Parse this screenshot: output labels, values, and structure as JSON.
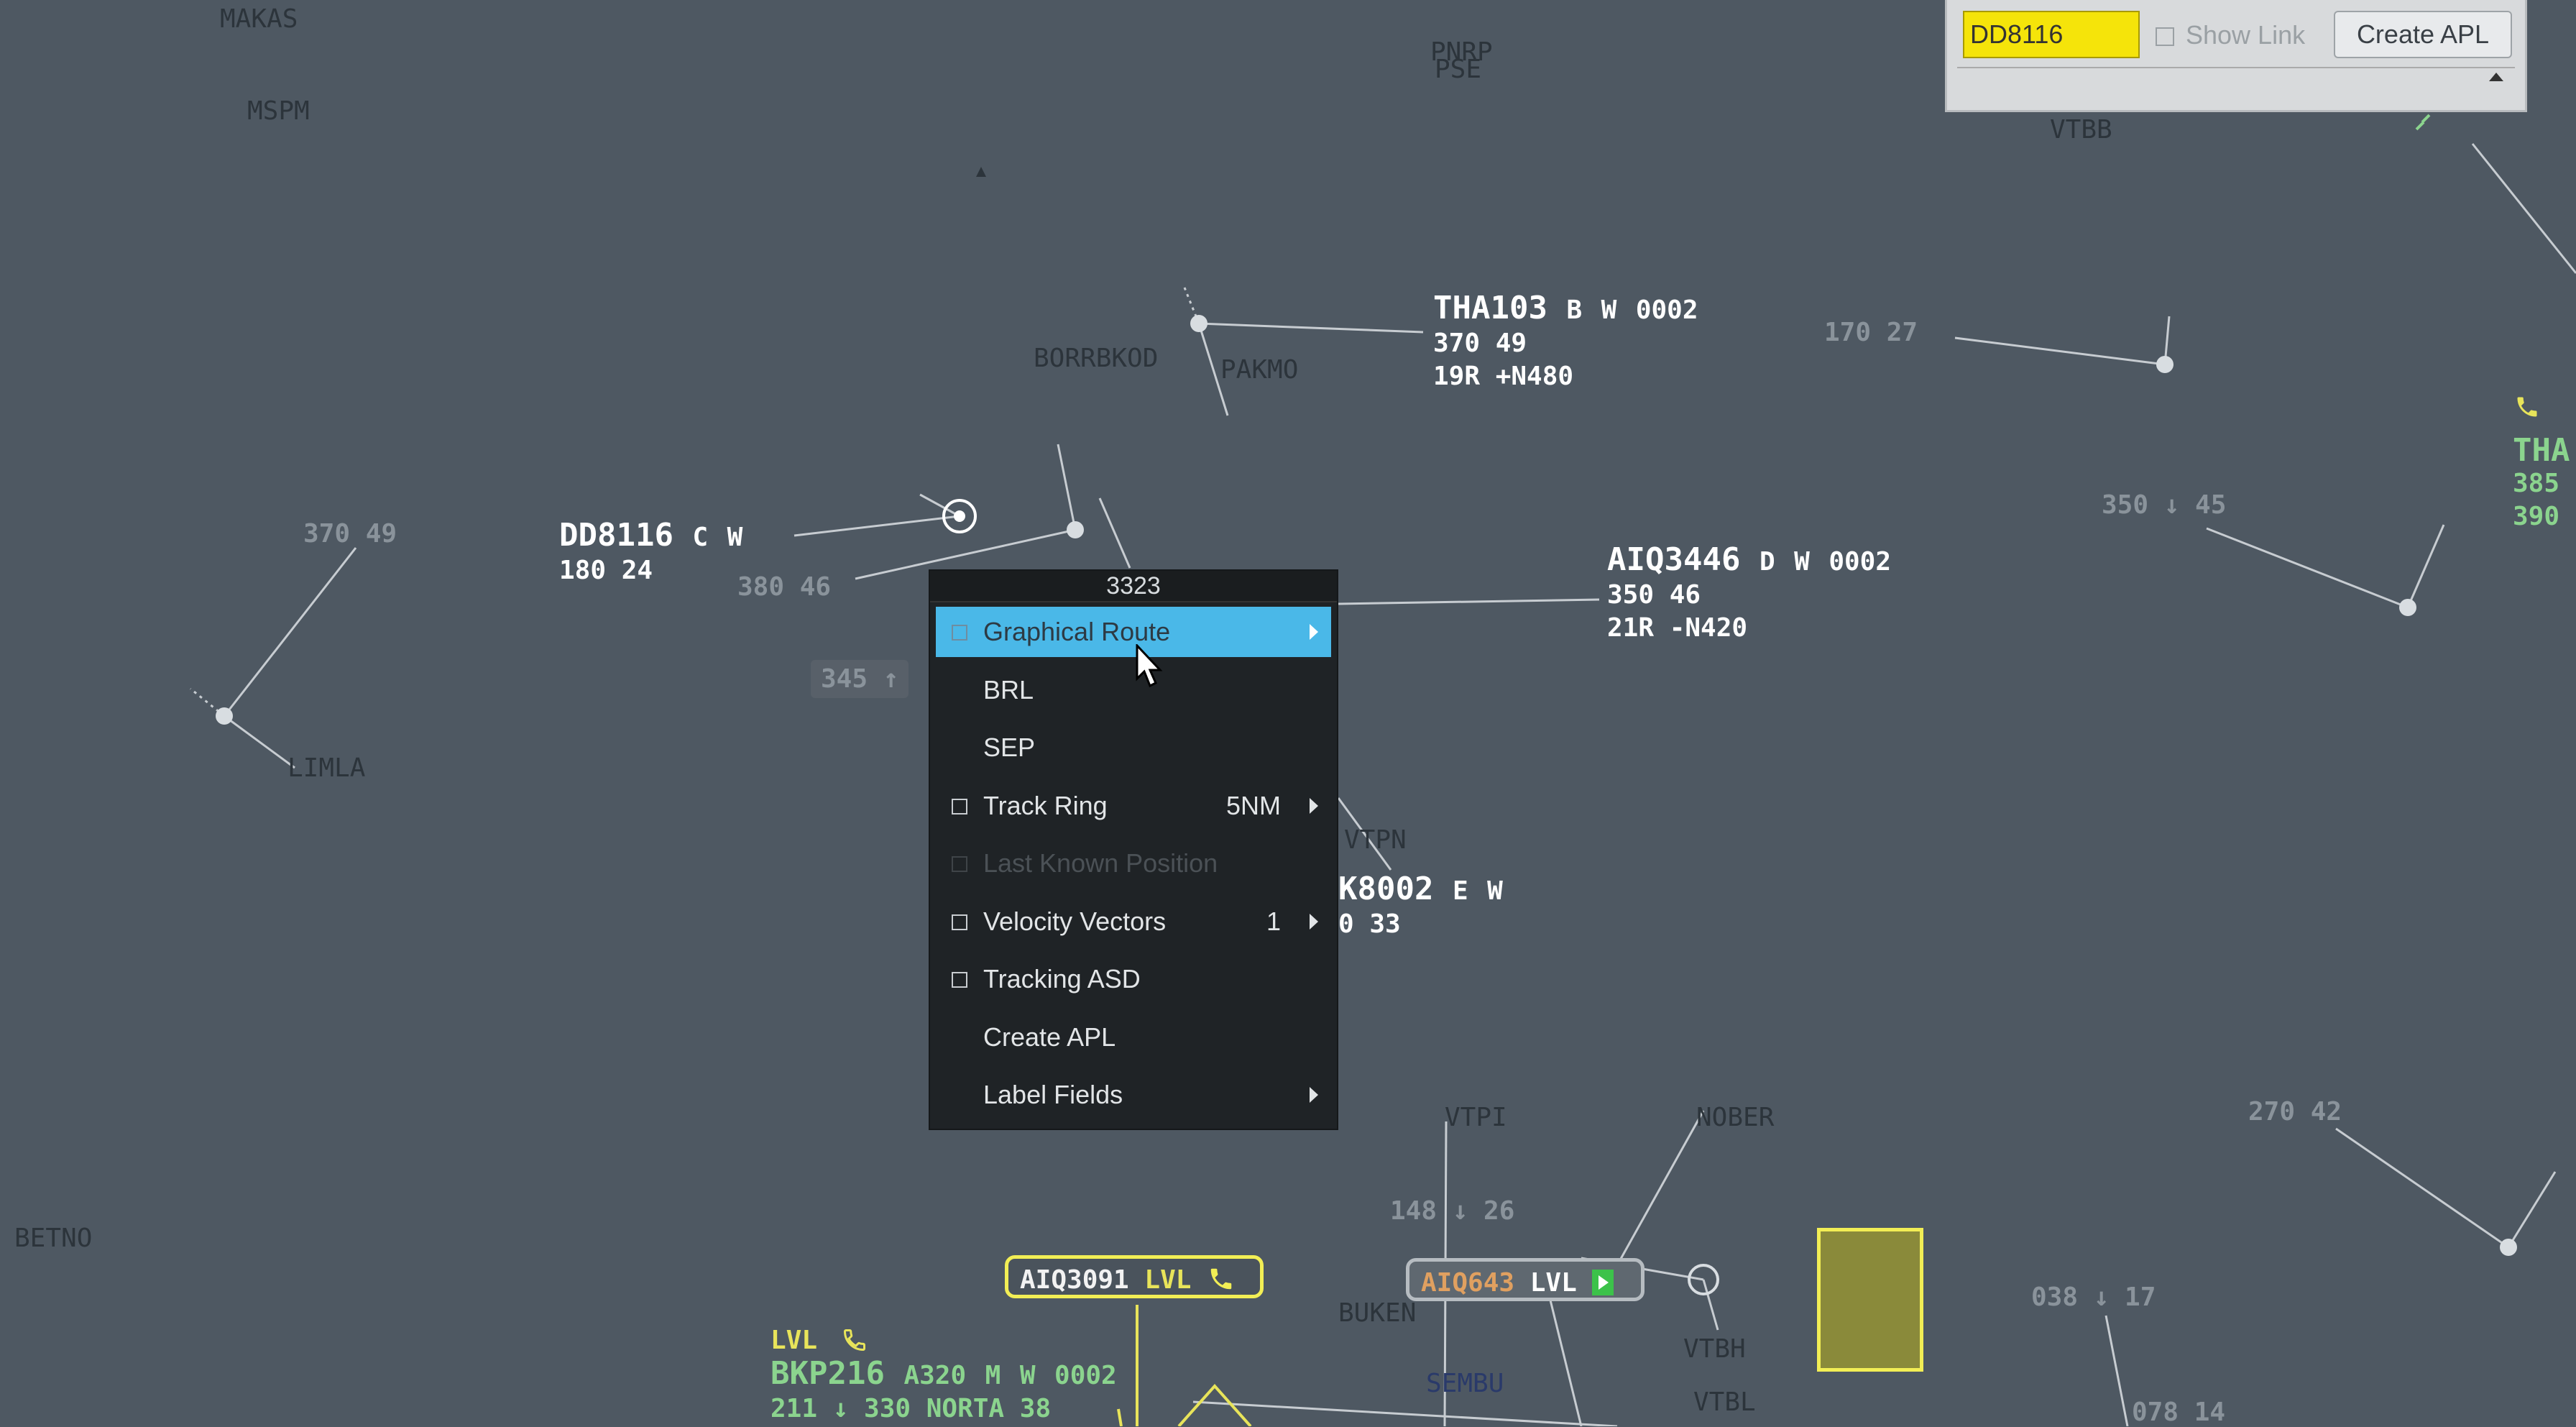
{
  "panel": {
    "callsign_value": "DD8116",
    "show_link_label": "Show Link",
    "create_apl_label": "Create APL"
  },
  "waypoints": {
    "makas": "MAKAS",
    "mspm": "MSPM",
    "borbkod": "BORRBKOD",
    "pakmo": "PAKMO",
    "limla": "LIMLA",
    "vtpn": "VTPN",
    "betno": "BETNO",
    "vtpi": "VTPI",
    "nober": "NOBER",
    "buken": "BUKEN",
    "sembu": "SEMBU",
    "vtbh": "VTBH",
    "vtbl": "VTBL",
    "top1": "PNRP",
    "top2": "PSE",
    "vtbb": "VTBB"
  },
  "tracks": {
    "tha103": {
      "callsign": "THA103",
      "cat": "B",
      "wake": "W",
      "squawk": "0002",
      "line2": "370  49",
      "line3": "19R +N480"
    },
    "dd8116": {
      "callsign": "DD8116",
      "cat": "C",
      "wake": "W",
      "line2": "180  24"
    },
    "aiq3446": {
      "callsign": "AIQ3446",
      "cat": "D",
      "wake": "W",
      "squawk": "0002",
      "line2": "350  46",
      "line3": "21R -N420"
    },
    "k8002": {
      "callsign": "K8002",
      "cat": "E",
      "wake": "W",
      "line2": "0  33"
    },
    "bkp216": {
      "status": "LVL",
      "callsign": "BKP216",
      "type": "A320",
      "cat": "M",
      "wake": "W",
      "squawk": "0002",
      "line3": "211 ↓ 330 NORTA  38"
    }
  },
  "dim_labels": {
    "l370_49": "370  49",
    "l380_46": "380  46",
    "l345": "345 ↑",
    "l170_27": "170  27",
    "l350_45": "350 ↓ 45",
    "l148_26": "148 ↓  26",
    "l270_42": "270  42",
    "l038_17": "038 ↓  17",
    "l078_14": "078  14",
    "tha_right": "THA",
    "r385": "385",
    "r390": "390"
  },
  "tags": {
    "aiq3091": {
      "callsign": "AIQ3091",
      "status": "LVL"
    },
    "aiq643": {
      "callsign": "AIQ643",
      "status": "LVL"
    }
  },
  "menu": {
    "title": "3323",
    "items": [
      {
        "label": "Graphical Route",
        "checkbox": true,
        "submenu": true,
        "value": "",
        "highlighted": true,
        "disabled": false
      },
      {
        "label": "BRL",
        "checkbox": false,
        "submenu": false,
        "value": "",
        "highlighted": false,
        "disabled": false
      },
      {
        "label": "SEP",
        "checkbox": false,
        "submenu": false,
        "value": "",
        "highlighted": false,
        "disabled": false
      },
      {
        "label": "Track Ring",
        "checkbox": true,
        "submenu": true,
        "value": "5NM",
        "highlighted": false,
        "disabled": false
      },
      {
        "label": "Last Known Position",
        "checkbox": true,
        "submenu": false,
        "value": "",
        "highlighted": false,
        "disabled": true
      },
      {
        "label": "Velocity Vectors",
        "checkbox": true,
        "submenu": true,
        "value": "1",
        "highlighted": false,
        "disabled": false
      },
      {
        "label": "Tracking ASD",
        "checkbox": true,
        "submenu": false,
        "value": "",
        "highlighted": false,
        "disabled": false
      },
      {
        "label": "Create APL",
        "checkbox": false,
        "submenu": false,
        "value": "",
        "highlighted": false,
        "disabled": false
      },
      {
        "label": "Label Fields",
        "checkbox": false,
        "submenu": true,
        "value": "",
        "highlighted": false,
        "disabled": false
      }
    ]
  },
  "colors": {
    "background": "#4e5862",
    "menu_highlight": "#4ab8e8",
    "input_yellow": "#f5e40a",
    "tag_yellow": "#f2ee55",
    "tag_green": "#3cc24a",
    "orange_text": "#e0a060",
    "light_green": "#8bd48e",
    "olive_block": "#8a8a3a"
  },
  "icons": {
    "cursor": "arrow-cursor-icon",
    "phone": "phone-icon",
    "play": "play-icon"
  }
}
